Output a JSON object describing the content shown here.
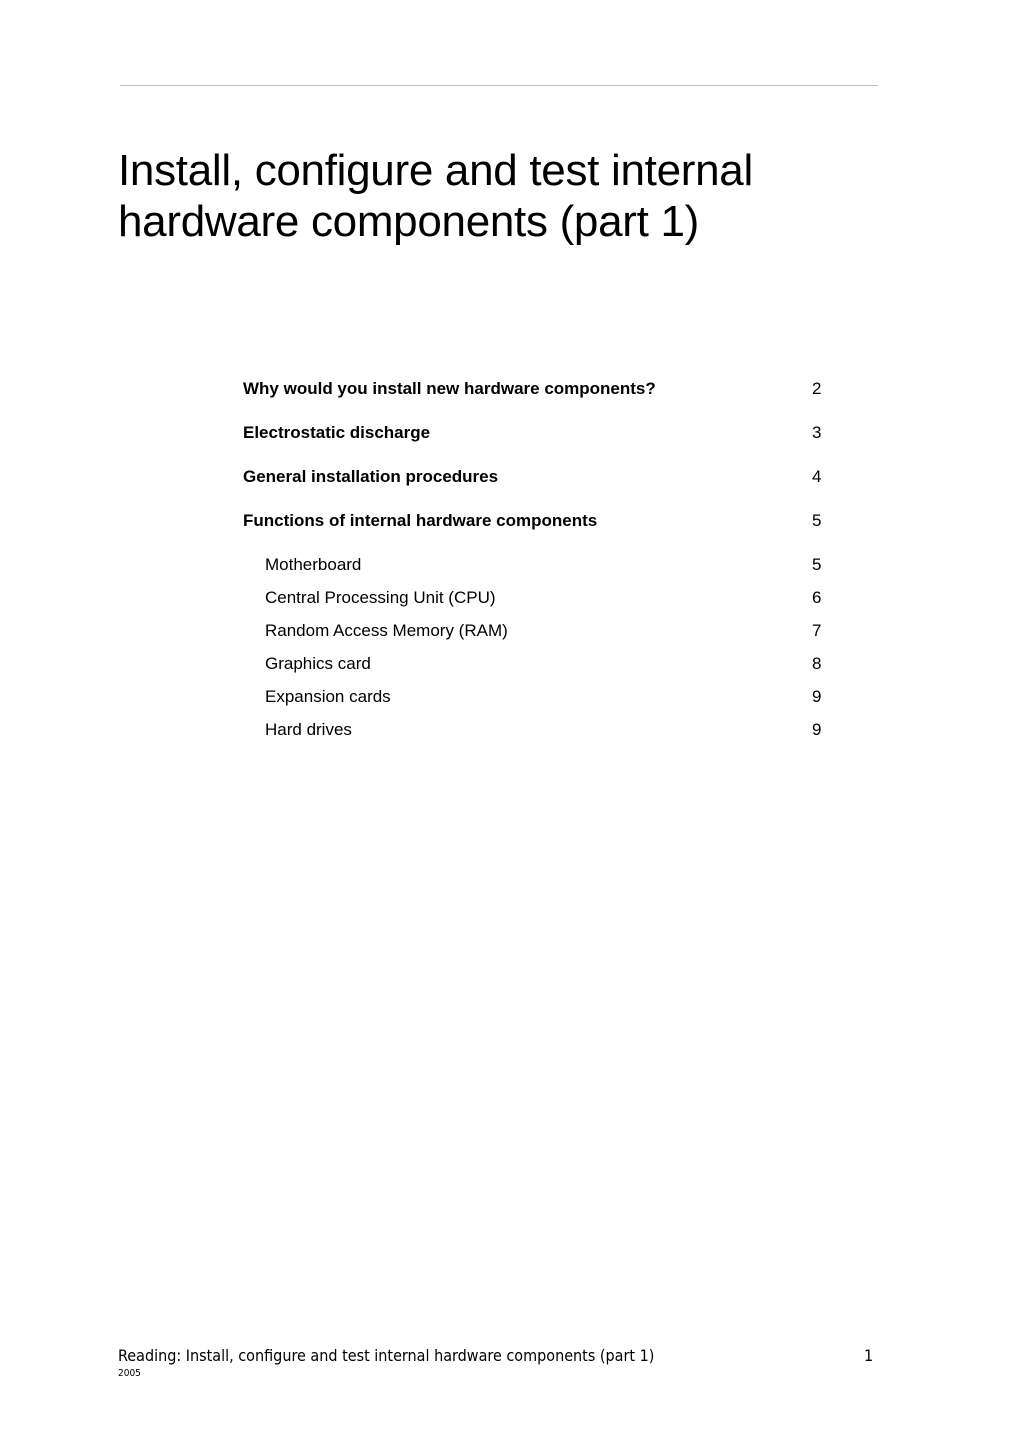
{
  "document": {
    "title": "Install, configure and test internal\nhardware components (part 1)"
  },
  "toc": {
    "entries": [
      {
        "label": "Why would you install new hardware components?",
        "page": "2",
        "level": 1
      },
      {
        "label": "Electrostatic discharge",
        "page": "3",
        "level": 1
      },
      {
        "label": "General installation procedures",
        "page": "4",
        "level": 1
      },
      {
        "label": "Functions of internal hardware components",
        "page": "5",
        "level": 1
      },
      {
        "label": "Motherboard",
        "page": "5",
        "level": 2
      },
      {
        "label": "Central Processing Unit (CPU)",
        "page": "6",
        "level": 2
      },
      {
        "label": "Random Access Memory (RAM)",
        "page": "7",
        "level": 2
      },
      {
        "label": "Graphics card",
        "page": "8",
        "level": 2
      },
      {
        "label": "Expansion cards",
        "page": "9",
        "level": 2
      },
      {
        "label": "Hard drives",
        "page": "9",
        "level": 2
      }
    ]
  },
  "footer": {
    "text": "Reading: Install, configure and test internal hardware components (part 1)",
    "year": "2005",
    "page_number": "1"
  },
  "colors": {
    "text": "#000000",
    "rule": "#bfbfbf",
    "background": "#ffffff"
  }
}
